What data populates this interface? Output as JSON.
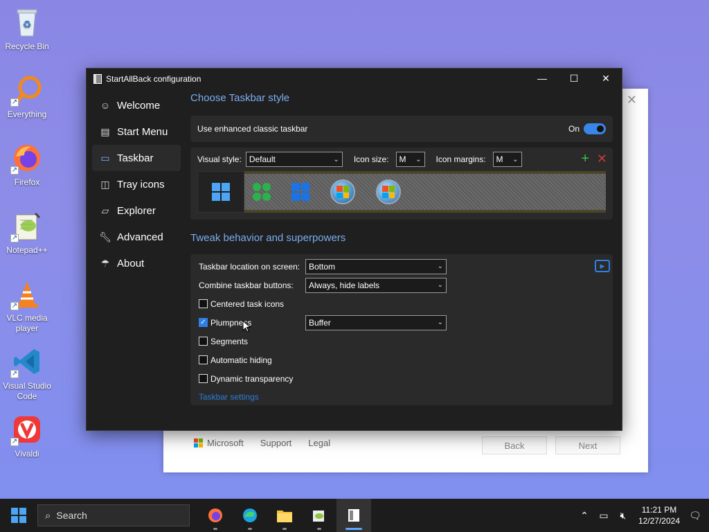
{
  "desktop": {
    "icons": [
      {
        "label": "Recycle Bin"
      },
      {
        "label": "Everything"
      },
      {
        "label": "Firefox"
      },
      {
        "label": "Notepad++"
      },
      {
        "label": "VLC media player"
      },
      {
        "label": "Visual Studio Code"
      },
      {
        "label": "Vivaldi"
      }
    ]
  },
  "bg_window": {
    "footer": {
      "brand": "Microsoft",
      "support": "Support",
      "legal": "Legal"
    },
    "back": "Back",
    "next": "Next"
  },
  "window": {
    "title": "StartAllBack configuration",
    "nav": [
      {
        "label": "Welcome",
        "icon": "smile-icon"
      },
      {
        "label": "Start Menu",
        "icon": "start-menu-icon"
      },
      {
        "label": "Taskbar",
        "icon": "taskbar-icon"
      },
      {
        "label": "Tray icons",
        "icon": "tray-icon"
      },
      {
        "label": "Explorer",
        "icon": "folder-icon"
      },
      {
        "label": "Advanced",
        "icon": "wrench-icon"
      },
      {
        "label": "About",
        "icon": "about-icon"
      }
    ],
    "taskbar_style": {
      "title": "Choose Taskbar style",
      "enhanced_label": "Use enhanced classic taskbar",
      "toggle_state": "On",
      "visual_style_label": "Visual style:",
      "visual_style_value": "Default",
      "icon_size_label": "Icon size:",
      "icon_size_value": "M",
      "icon_margins_label": "Icon margins:",
      "icon_margins_value": "M"
    },
    "tweak": {
      "title": "Tweak behavior and superpowers",
      "location_label": "Taskbar location on screen:",
      "location_value": "Bottom",
      "combine_label": "Combine taskbar buttons:",
      "combine_value": "Always, hide labels",
      "centered_label": "Centered task icons",
      "plumpness_label": "Plumpness",
      "plumpness_value": "Buffer",
      "segments_label": "Segments",
      "autohide_label": "Automatic hiding",
      "transparency_label": "Dynamic transparency",
      "settings_link": "Taskbar settings"
    }
  },
  "taskbar": {
    "search_label": "Search",
    "time": "11:21 PM",
    "date": "12/27/2024"
  },
  "colors": {
    "accent": "#7aaef0",
    "toggle_on": "#3a86e8",
    "link": "#2e7bd6"
  }
}
